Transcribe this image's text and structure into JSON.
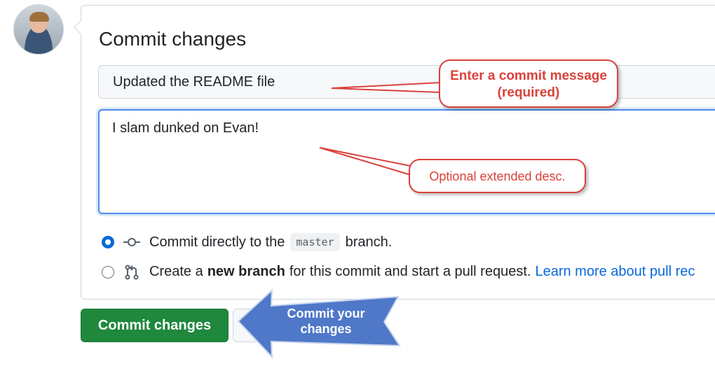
{
  "header": {
    "title": "Commit changes"
  },
  "form": {
    "summary_value": "Updated the README file",
    "description_value": "I slam dunked on Evan!"
  },
  "options": {
    "direct": {
      "prefix": "Commit directly to the",
      "branch": "master",
      "suffix": "branch.",
      "checked": true
    },
    "new_branch": {
      "prefix": "Create a",
      "bold": "new branch",
      "suffix": "for this commit and start a pull request.",
      "link": "Learn more about pull rec",
      "checked": false
    }
  },
  "actions": {
    "commit_label": "Commit changes"
  },
  "annotations": {
    "callout_message": "Enter a commit message (required)",
    "callout_description": "Optional extended desc.",
    "arrow_label": "Commit your changes"
  },
  "colors": {
    "primary_button": "#1f883d",
    "link": "#0969da",
    "callout": "#d9423a",
    "arrow": "#4f78c8"
  }
}
